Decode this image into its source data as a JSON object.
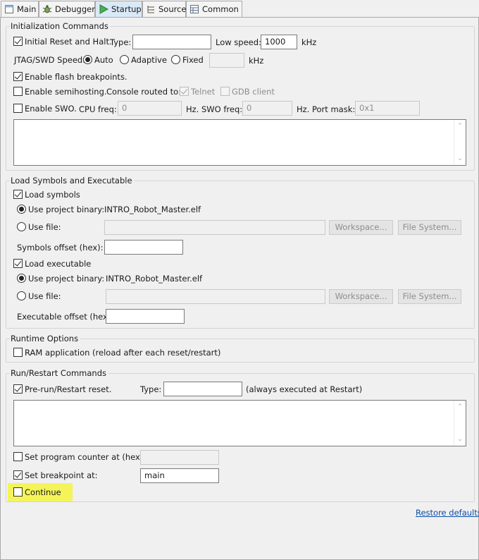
{
  "tabs": [
    {
      "label": "Main",
      "icon": "main-tab-icon"
    },
    {
      "label": "Debugger",
      "icon": "debugger-bug-icon"
    },
    {
      "label": "Startup",
      "icon": "play-arrow-icon",
      "active": true
    },
    {
      "label": "Source",
      "icon": "source-icon"
    },
    {
      "label": "Common",
      "icon": "common-table-icon"
    }
  ],
  "init": {
    "title": "Initialization Commands",
    "reset_halt_label": "Initial Reset and Halt.",
    "type_label": "Type:",
    "type_value": "",
    "low_speed_label": "Low speed:",
    "low_speed_value": "1000",
    "khz": "kHz",
    "jtag_label": "JTAG/SWD Speed:",
    "auto_label": "Auto",
    "adaptive_label": "Adaptive",
    "fixed_label": "Fixed",
    "fixed_value": "",
    "flash_bp_label": "Enable flash breakpoints.",
    "semihosting_label": "Enable semihosting.",
    "console_label": "Console routed to:",
    "telnet_label": "Telnet",
    "gdb_client_label": "GDB client",
    "swo_label": "Enable SWO.",
    "cpu_freq_label": "CPU freq:",
    "cpu_freq_value": "0",
    "hz1": "Hz.",
    "swo_freq_label": "SWO freq:",
    "swo_freq_value": "0",
    "hz2": "Hz.",
    "port_mask_label": "Port mask:",
    "port_mask_value": "0x1"
  },
  "load": {
    "title": "Load Symbols and Executable",
    "load_symbols_label": "Load symbols",
    "use_project_binary_label": "Use project binary:",
    "symbols_binary": "INTRO_Robot_Master.elf",
    "use_file_label": "Use file:",
    "workspace_label": "Workspace...",
    "filesystem_label": "File System...",
    "symbols_offset_label": "Symbols offset (hex):",
    "load_executable_label": "Load executable",
    "use_project_binary_label_2": "Use project binary:",
    "executable_binary": "INTRO_Robot_Master.elf",
    "use_file_label_2": "Use file:",
    "workspace_label_2": "Workspace...",
    "filesystem_label_2": "File System...",
    "executable_offset_label": "Executable offset (hex):"
  },
  "runtime": {
    "title": "Runtime Options",
    "ram_app_label": "RAM application (reload after each reset/restart)"
  },
  "run": {
    "title": "Run/Restart Commands",
    "prerun_label": "Pre-run/Restart reset.",
    "type_label": "Type:",
    "always_label": "(always executed at Restart)",
    "set_pc_label": "Set program counter at (hex):",
    "set_bp_label": "Set breakpoint at:",
    "bp_value": "main",
    "continue_label": "Continue"
  },
  "restore_defaults": "Restore defaults",
  "colors": {
    "highlight": "#f4f45a",
    "active_tab": "#d9e9f7",
    "link": "#0a4ea8"
  }
}
